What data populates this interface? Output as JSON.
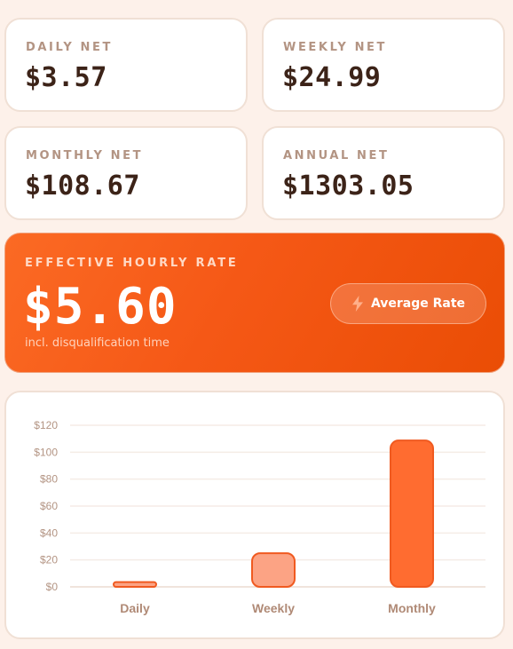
{
  "stats": {
    "daily": {
      "label": "DAILY NET",
      "value": "$3.57"
    },
    "weekly": {
      "label": "WEEKLY NET",
      "value": "$24.99"
    },
    "monthly": {
      "label": "MONTHLY NET",
      "value": "$108.67"
    },
    "annual": {
      "label": "ANNUAL NET",
      "value": "$1303.05"
    }
  },
  "rate": {
    "label": "EFFECTIVE HOURLY RATE",
    "value": "$5.60",
    "subtitle": "incl. disqualification time",
    "button_label": "Average Rate",
    "button_icon": "lightning-bolt-icon"
  },
  "colors": {
    "accent": "#f55816",
    "bar_light": "#fca384",
    "bar_dark": "#ff6c30",
    "bar_stroke": "#f05a20"
  },
  "chart_data": {
    "type": "bar",
    "categories": [
      "Daily",
      "Weekly",
      "Monthly"
    ],
    "values": [
      3.57,
      24.99,
      108.67
    ],
    "ylim": [
      0,
      120
    ],
    "yticks": [
      0,
      20,
      40,
      60,
      80,
      100,
      120
    ],
    "ytick_labels": [
      "$0",
      "$20",
      "$40",
      "$60",
      "$80",
      "$100",
      "$120"
    ],
    "grid": true,
    "title": "",
    "xlabel": "",
    "ylabel": ""
  }
}
